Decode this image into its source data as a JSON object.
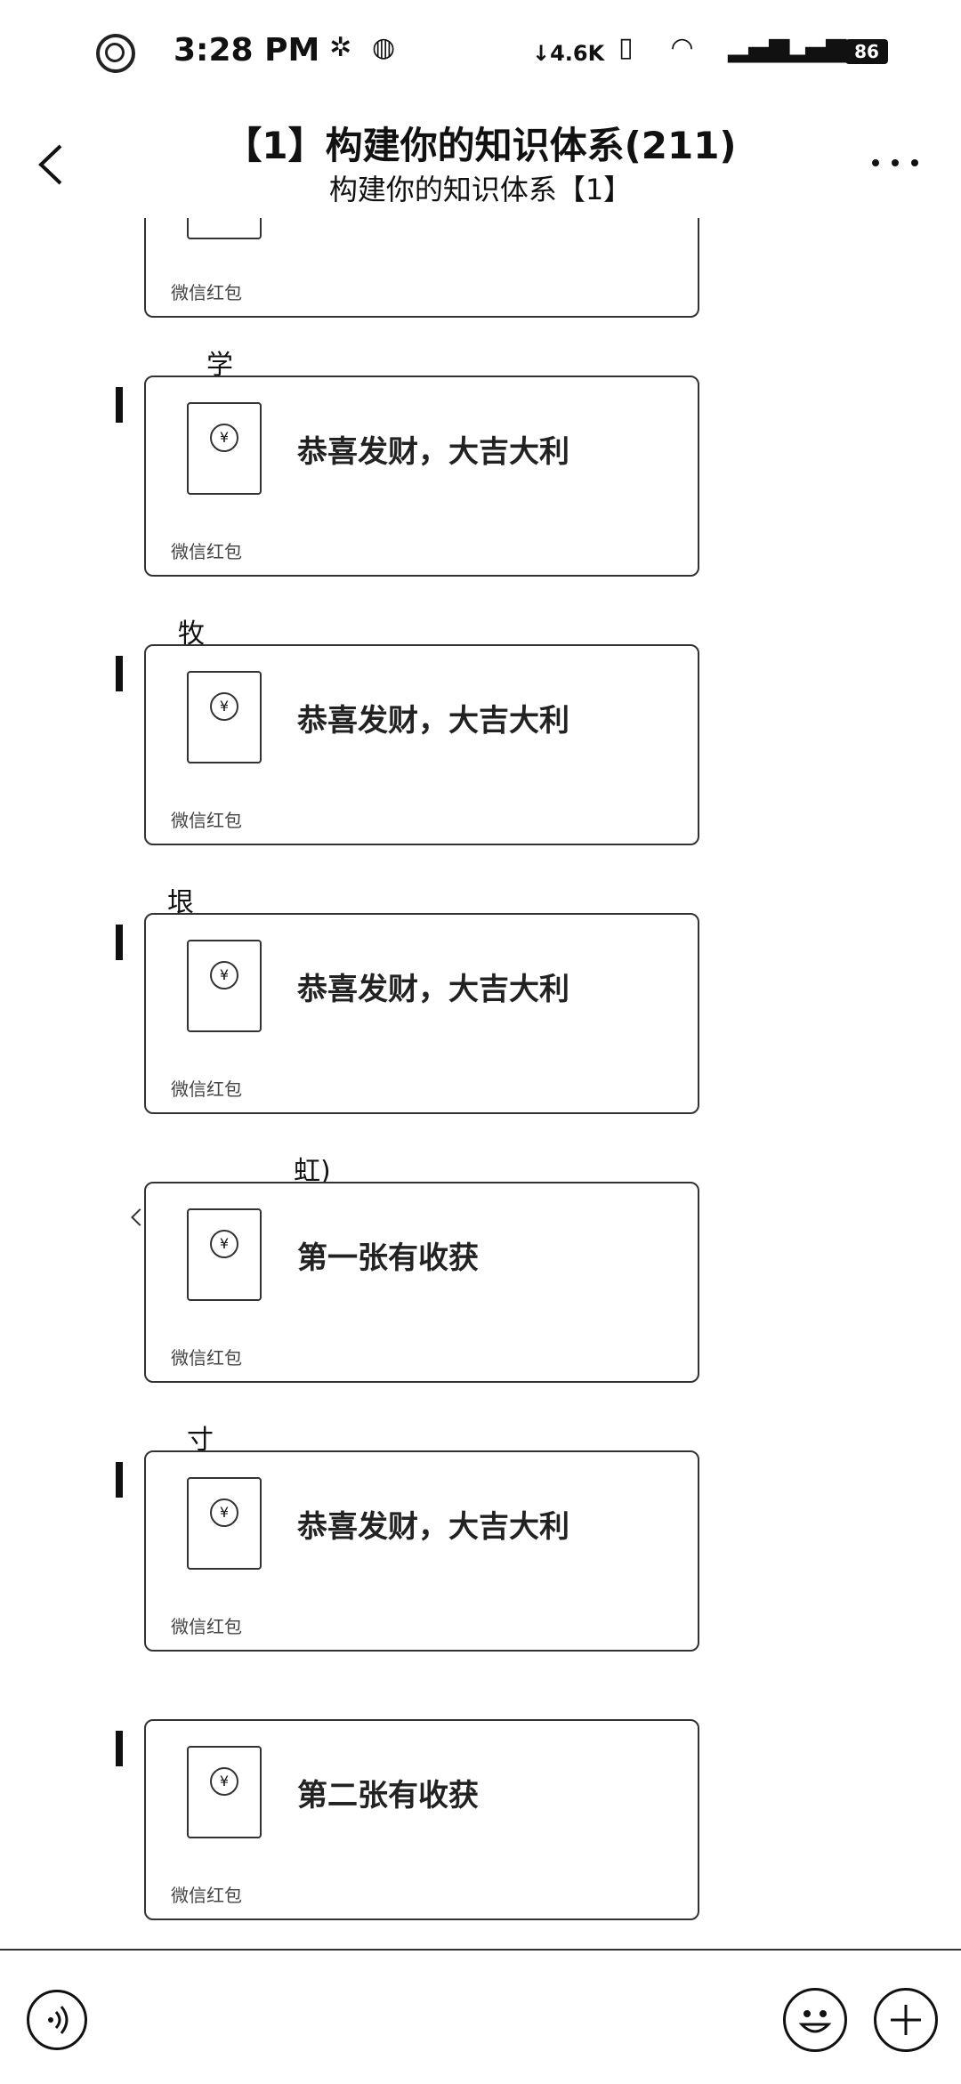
{
  "status_bar": {
    "time": "3:28 PM",
    "net_speed": "↓4.6K",
    "battery": "86",
    "icons": [
      "ring-icon",
      "flower-icon",
      "signal-logo-icon",
      "vibrate-icon",
      "wifi-icon",
      "cell-signal-icon",
      "cell-signal-2-icon"
    ]
  },
  "header": {
    "title": "【1】构建你的知识体系(211)",
    "subtitle": "构建你的知识体系【1】"
  },
  "messages": [
    {
      "sender": "",
      "text": "",
      "footer": "微信红包",
      "partial": true
    },
    {
      "sender": "学",
      "text": "恭喜发财，大吉大利",
      "footer": "微信红包"
    },
    {
      "sender": "牧",
      "text": "恭喜发财，大吉大利",
      "footer": "微信红包"
    },
    {
      "sender": "垠",
      "text": "恭喜发财，大吉大利",
      "footer": "微信红包"
    },
    {
      "sender": "虹)",
      "text": "第一张有收获",
      "footer": "微信红包"
    },
    {
      "sender": "寸",
      "text": "恭喜发财，大吉大利",
      "footer": "微信红包"
    },
    {
      "sender": "",
      "text": "第二张有收获",
      "footer": "微信红包"
    }
  ]
}
